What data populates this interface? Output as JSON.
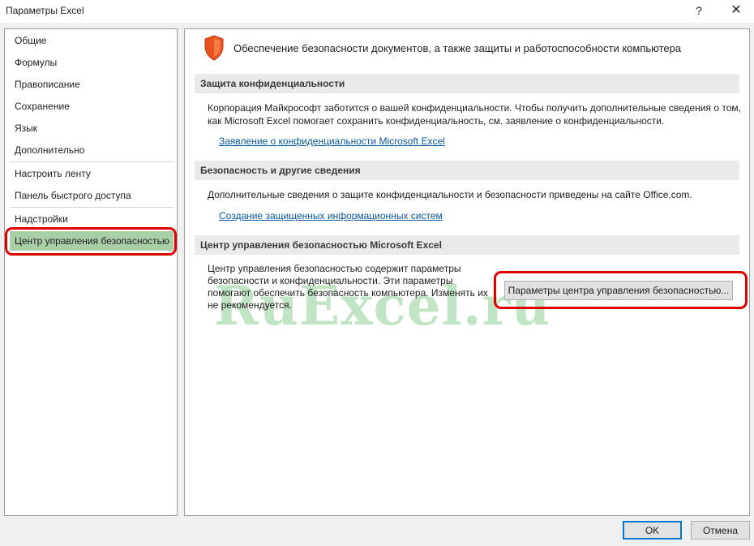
{
  "window": {
    "title": "Параметры Excel",
    "help_label": "?",
    "close_label": "✕"
  },
  "sidebar": {
    "items": [
      {
        "label": "Общие"
      },
      {
        "label": "Формулы"
      },
      {
        "label": "Правописание"
      },
      {
        "label": "Сохранение"
      },
      {
        "label": "Язык"
      },
      {
        "label": "Дополнительно"
      },
      {
        "label": "Настроить ленту"
      },
      {
        "label": "Панель быстрого доступа"
      },
      {
        "label": "Надстройки"
      },
      {
        "label": "Центр управления безопасностью"
      }
    ],
    "active_index": 9,
    "active_color": "#a9cfa9"
  },
  "main": {
    "header_icon": "shield-icon",
    "header": "Обеспечение безопасности документов, а также защиты и работоспособности компьютера",
    "privacy": {
      "title": "Защита конфиденциальности",
      "text_line1": "Корпорация Майкрософт заботится о вашей конфиденциальности. Чтобы получить дополнительные сведения о том,",
      "text_line2": "как Microsoft Excel помогает сохранить конфиденциальность, см. заявление о конфиденциальности.",
      "link": "Заявление о конфиденциальности Microsoft Excel"
    },
    "security": {
      "title": "Безопасность и другие сведения",
      "text": "Дополнительные сведения о защите конфиденциальности и безопасности приведены на сайте Office.com.",
      "link": "Создание защищенных информационных систем"
    },
    "trust_center": {
      "title": "Центр управления безопасностью Microsoft Excel",
      "text_lines": [
        "Центр управления безопасностью содержит параметры",
        "безопасности и конфиденциальности. Эти параметры",
        "помогают обеспечить безопасность компьютера. Изменять их",
        "не рекомендуется."
      ],
      "button": "Параметры центра управления безопасностью..."
    },
    "watermark": "RuExcel.ru"
  },
  "footer": {
    "ok": "OK",
    "cancel": "Отмена"
  },
  "colors": {
    "highlight": "#e00000",
    "link": "#0a58a8",
    "shield": "#e8501e"
  }
}
